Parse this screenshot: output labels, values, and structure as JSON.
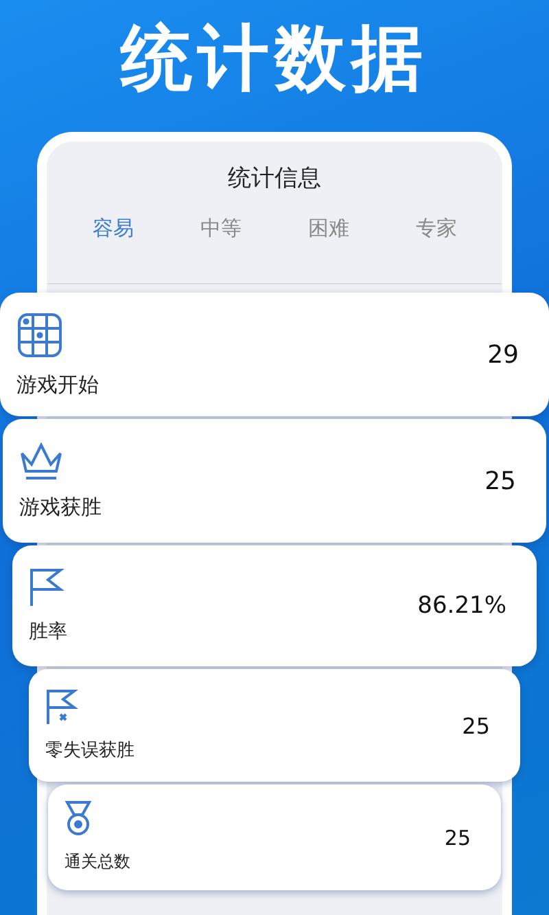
{
  "banner_title": "统计数据",
  "header": {
    "title": "统计信息"
  },
  "tabs": [
    {
      "label": "容易",
      "selected": true
    },
    {
      "label": "中等",
      "selected": false
    },
    {
      "label": "困难",
      "selected": false
    },
    {
      "label": "专家",
      "selected": false
    }
  ],
  "stats": [
    {
      "kind": "grid",
      "label": "游戏开始",
      "value": "29"
    },
    {
      "kind": "crown",
      "label": "游戏获胜",
      "value": "25"
    },
    {
      "kind": "flag",
      "label": "胜率",
      "value": "86.21%"
    },
    {
      "kind": "flagx",
      "label": "零失误获胜",
      "value": "25"
    },
    {
      "kind": "medal",
      "label": "通关总数",
      "value": "25"
    }
  ]
}
